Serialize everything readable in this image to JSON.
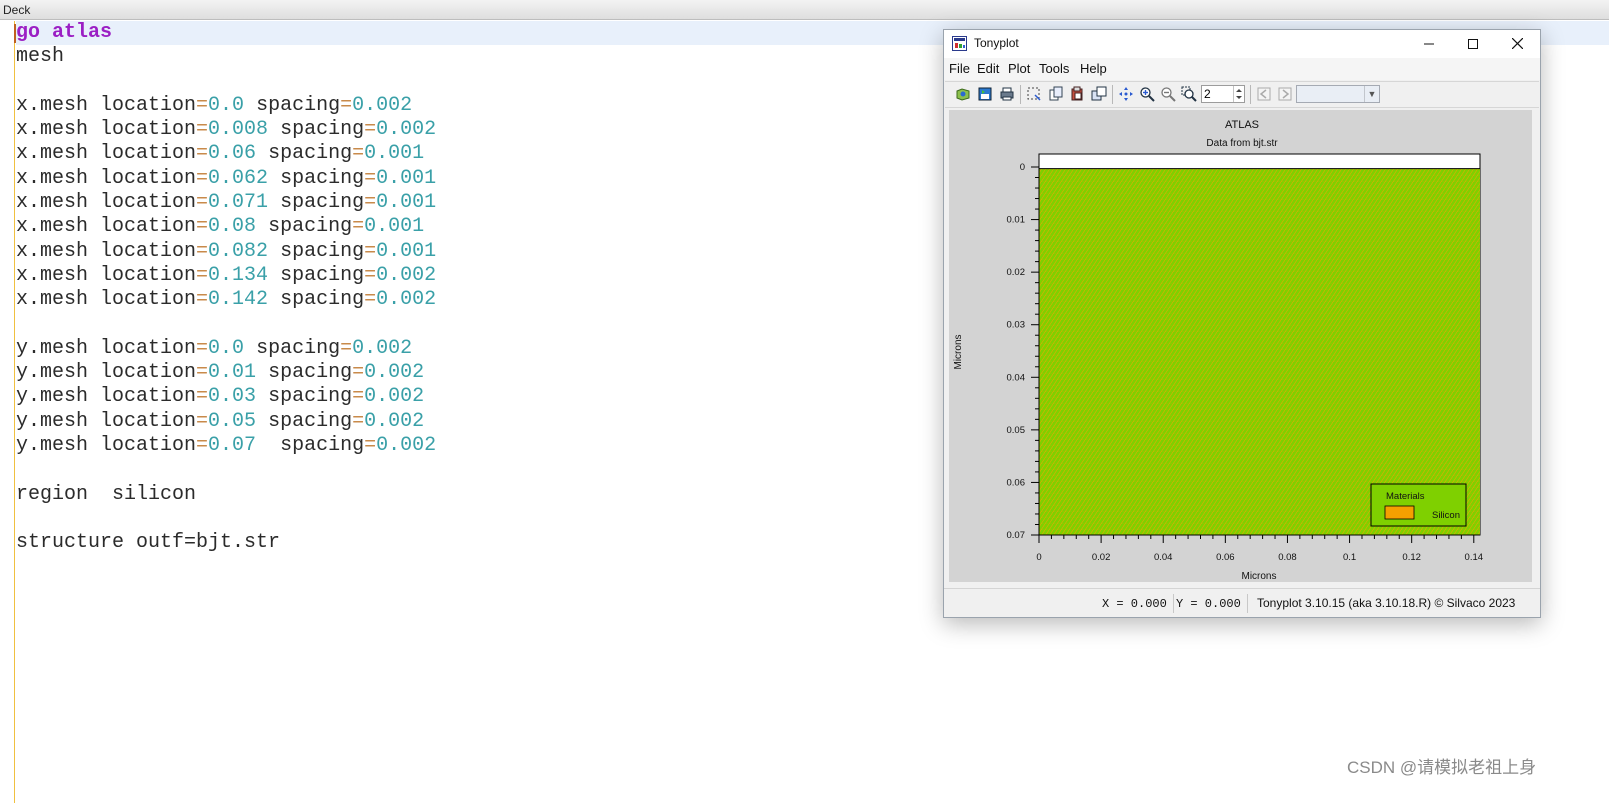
{
  "deck": {
    "title": "Deck"
  },
  "editor": {
    "lines": [
      [
        {
          "t": "go atlas",
          "c": "kw"
        }
      ],
      [
        {
          "t": "mesh"
        }
      ],
      [],
      [
        {
          "t": "x.mesh location"
        },
        {
          "t": "=",
          "c": "eq"
        },
        {
          "t": "0.0",
          "c": "num"
        },
        {
          "t": " spacing"
        },
        {
          "t": "=",
          "c": "eq"
        },
        {
          "t": "0.002",
          "c": "num"
        }
      ],
      [
        {
          "t": "x.mesh location"
        },
        {
          "t": "=",
          "c": "eq"
        },
        {
          "t": "0.008",
          "c": "num"
        },
        {
          "t": " spacing"
        },
        {
          "t": "=",
          "c": "eq"
        },
        {
          "t": "0.002",
          "c": "num"
        }
      ],
      [
        {
          "t": "x.mesh location"
        },
        {
          "t": "=",
          "c": "eq"
        },
        {
          "t": "0.06",
          "c": "num"
        },
        {
          "t": " spacing"
        },
        {
          "t": "=",
          "c": "eq"
        },
        {
          "t": "0.001",
          "c": "num"
        }
      ],
      [
        {
          "t": "x.mesh location"
        },
        {
          "t": "=",
          "c": "eq"
        },
        {
          "t": "0.062",
          "c": "num"
        },
        {
          "t": " spacing"
        },
        {
          "t": "=",
          "c": "eq"
        },
        {
          "t": "0.001",
          "c": "num"
        }
      ],
      [
        {
          "t": "x.mesh location"
        },
        {
          "t": "=",
          "c": "eq"
        },
        {
          "t": "0.071",
          "c": "num"
        },
        {
          "t": " spacing"
        },
        {
          "t": "=",
          "c": "eq"
        },
        {
          "t": "0.001",
          "c": "num"
        }
      ],
      [
        {
          "t": "x.mesh location"
        },
        {
          "t": "=",
          "c": "eq"
        },
        {
          "t": "0.08",
          "c": "num"
        },
        {
          "t": " spacing"
        },
        {
          "t": "=",
          "c": "eq"
        },
        {
          "t": "0.001",
          "c": "num"
        }
      ],
      [
        {
          "t": "x.mesh location"
        },
        {
          "t": "=",
          "c": "eq"
        },
        {
          "t": "0.082",
          "c": "num"
        },
        {
          "t": " spacing"
        },
        {
          "t": "=",
          "c": "eq"
        },
        {
          "t": "0.001",
          "c": "num"
        }
      ],
      [
        {
          "t": "x.mesh location"
        },
        {
          "t": "=",
          "c": "eq"
        },
        {
          "t": "0.134",
          "c": "num"
        },
        {
          "t": " spacing"
        },
        {
          "t": "=",
          "c": "eq"
        },
        {
          "t": "0.002",
          "c": "num"
        }
      ],
      [
        {
          "t": "x.mesh location"
        },
        {
          "t": "=",
          "c": "eq"
        },
        {
          "t": "0.142",
          "c": "num"
        },
        {
          "t": " spacing"
        },
        {
          "t": "=",
          "c": "eq"
        },
        {
          "t": "0.002",
          "c": "num"
        }
      ],
      [],
      [
        {
          "t": "y.mesh location"
        },
        {
          "t": "=",
          "c": "eq"
        },
        {
          "t": "0.0",
          "c": "num"
        },
        {
          "t": " spacing"
        },
        {
          "t": "=",
          "c": "eq"
        },
        {
          "t": "0.002",
          "c": "num"
        }
      ],
      [
        {
          "t": "y.mesh location"
        },
        {
          "t": "=",
          "c": "eq"
        },
        {
          "t": "0.01",
          "c": "num"
        },
        {
          "t": " spacing"
        },
        {
          "t": "=",
          "c": "eq"
        },
        {
          "t": "0.002",
          "c": "num"
        }
      ],
      [
        {
          "t": "y.mesh location"
        },
        {
          "t": "=",
          "c": "eq"
        },
        {
          "t": "0.03",
          "c": "num"
        },
        {
          "t": " spacing"
        },
        {
          "t": "=",
          "c": "eq"
        },
        {
          "t": "0.002",
          "c": "num"
        }
      ],
      [
        {
          "t": "y.mesh location"
        },
        {
          "t": "=",
          "c": "eq"
        },
        {
          "t": "0.05",
          "c": "num"
        },
        {
          "t": " spacing"
        },
        {
          "t": "=",
          "c": "eq"
        },
        {
          "t": "0.002",
          "c": "num"
        }
      ],
      [
        {
          "t": "y.mesh location"
        },
        {
          "t": "=",
          "c": "eq"
        },
        {
          "t": "0.07",
          "c": "num"
        },
        {
          "t": "  spacing"
        },
        {
          "t": "=",
          "c": "eq"
        },
        {
          "t": "0.002",
          "c": "num"
        }
      ],
      [],
      [
        {
          "t": "region  silicon"
        }
      ],
      [],
      [
        {
          "t": "structure outf=bjt.str"
        }
      ]
    ]
  },
  "tonyplot": {
    "title": "Tonyplot",
    "menu": [
      {
        "label": "File",
        "name": "menu-file"
      },
      {
        "label": "Edit",
        "name": "menu-edit"
      },
      {
        "label": "Plot",
        "name": "menu-plot"
      },
      {
        "label": "Tools",
        "name": "menu-tools"
      },
      {
        "label": "Help",
        "name": "menu-help"
      }
    ],
    "zoom_value": "2",
    "status": {
      "x": "X = 0.000",
      "y": "Y = 0.000",
      "version": "Tonyplot 3.10.15 (aka 3.10.18.R) © Silvaco 2023"
    }
  },
  "chart_data": {
    "type": "heatmap",
    "title": "ATLAS",
    "subtitle": "Data from bjt.str",
    "xlabel": "Microns",
    "ylabel": "Microns",
    "xlim": [
      0,
      0.142
    ],
    "ylim": [
      0.07,
      0
    ],
    "x_ticks": [
      0,
      0.02,
      0.04,
      0.06,
      0.08,
      0.1,
      0.12,
      0.14
    ],
    "y_ticks": [
      0,
      0.01,
      0.02,
      0.03,
      0.04,
      0.05,
      0.06,
      0.07
    ],
    "region": {
      "material": "Silicon",
      "color": "#7fd000",
      "mesh_color": "#f5a000",
      "y_top": 0.0003
    },
    "legend": {
      "title": "Materials",
      "entries": [
        {
          "label": "Silicon",
          "color": "#f5a000"
        }
      ],
      "position": "bottom-right"
    }
  },
  "watermark": "CSDN @请模拟老祖上身"
}
